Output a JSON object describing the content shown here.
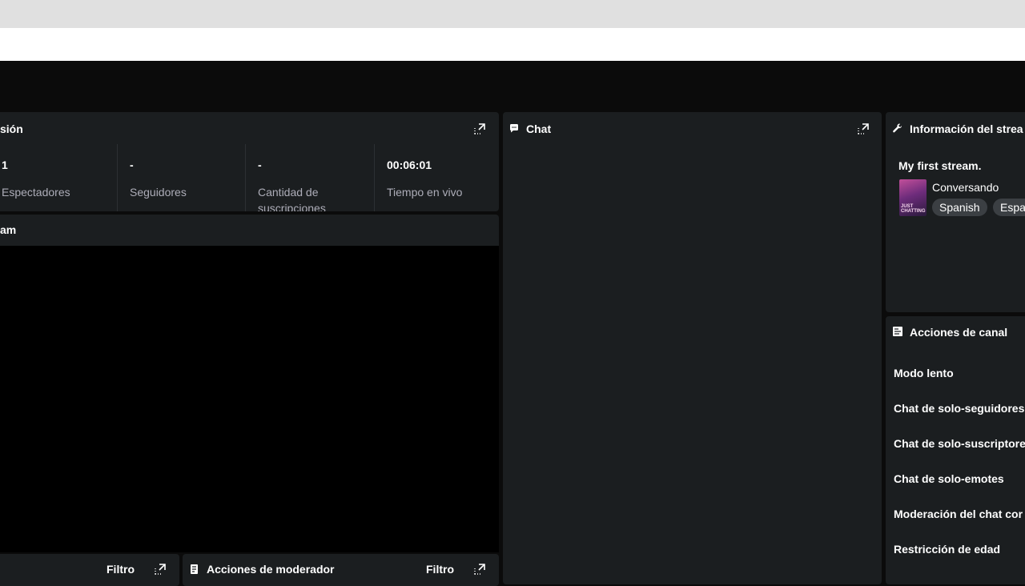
{
  "session": {
    "title": "sión",
    "stats": [
      {
        "value": "1",
        "label": "Espectadores"
      },
      {
        "value": "-",
        "label": "Seguidores"
      },
      {
        "value": "-",
        "label": "Cantidad de suscripciones"
      },
      {
        "value": "00:06:01",
        "label": "Tiempo en vivo"
      }
    ]
  },
  "stream_preview": {
    "title": "am"
  },
  "chat": {
    "title": "Chat"
  },
  "stream_info": {
    "title": "Información del strea",
    "stream_title": "My first stream.",
    "category": "Conversando",
    "thumb_text": "JUST CHATTING",
    "tags": [
      "Spanish",
      "Espa"
    ]
  },
  "channel_actions": {
    "title": "Acciones de canal",
    "items": [
      "Modo lento",
      "Chat de solo-seguidores",
      "Chat de solo-suscriptore",
      "Chat de solo-emotes",
      "Moderación del chat cor",
      "Restricción de edad"
    ]
  },
  "activity_panel": {
    "filter_label": "Filtro"
  },
  "mod_actions": {
    "title": "Acciones de moderador",
    "filter_label": "Filtro"
  },
  "colors": {
    "panel_bg": "#1b1e20",
    "page_bg": "#0b0b0b",
    "muted_text": "#adadb8",
    "tag_bg": "#3b3f43"
  }
}
